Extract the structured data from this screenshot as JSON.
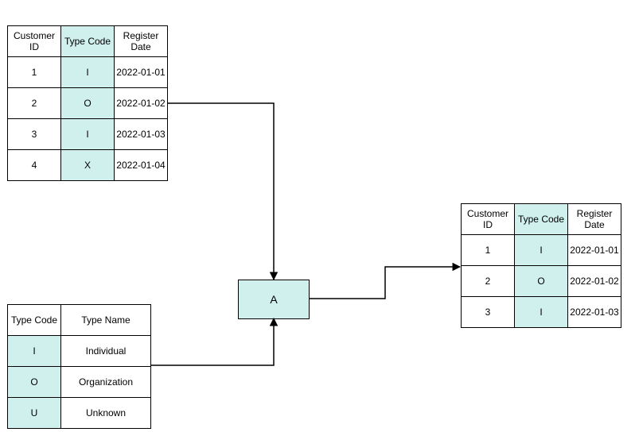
{
  "table1": {
    "headers": [
      "Customer ID",
      "Type Code",
      "Register Date"
    ],
    "rows": [
      [
        "1",
        "I",
        "2022-01-01"
      ],
      [
        "2",
        "O",
        "2022-01-02"
      ],
      [
        "3",
        "I",
        "2022-01-03"
      ],
      [
        "4",
        "X",
        "2022-01-04"
      ]
    ]
  },
  "table2": {
    "headers": [
      "Type Code",
      "Type Name"
    ],
    "rows": [
      [
        "I",
        "Individual"
      ],
      [
        "O",
        "Organization"
      ],
      [
        "U",
        "Unknown"
      ]
    ]
  },
  "table3": {
    "headers": [
      "Customer ID",
      "Type Code",
      "Register Date"
    ],
    "rows": [
      [
        "1",
        "I",
        "2022-01-01"
      ],
      [
        "2",
        "O",
        "2022-01-02"
      ],
      [
        "3",
        "I",
        "2022-01-03"
      ]
    ]
  },
  "boxA": {
    "label": "A"
  }
}
